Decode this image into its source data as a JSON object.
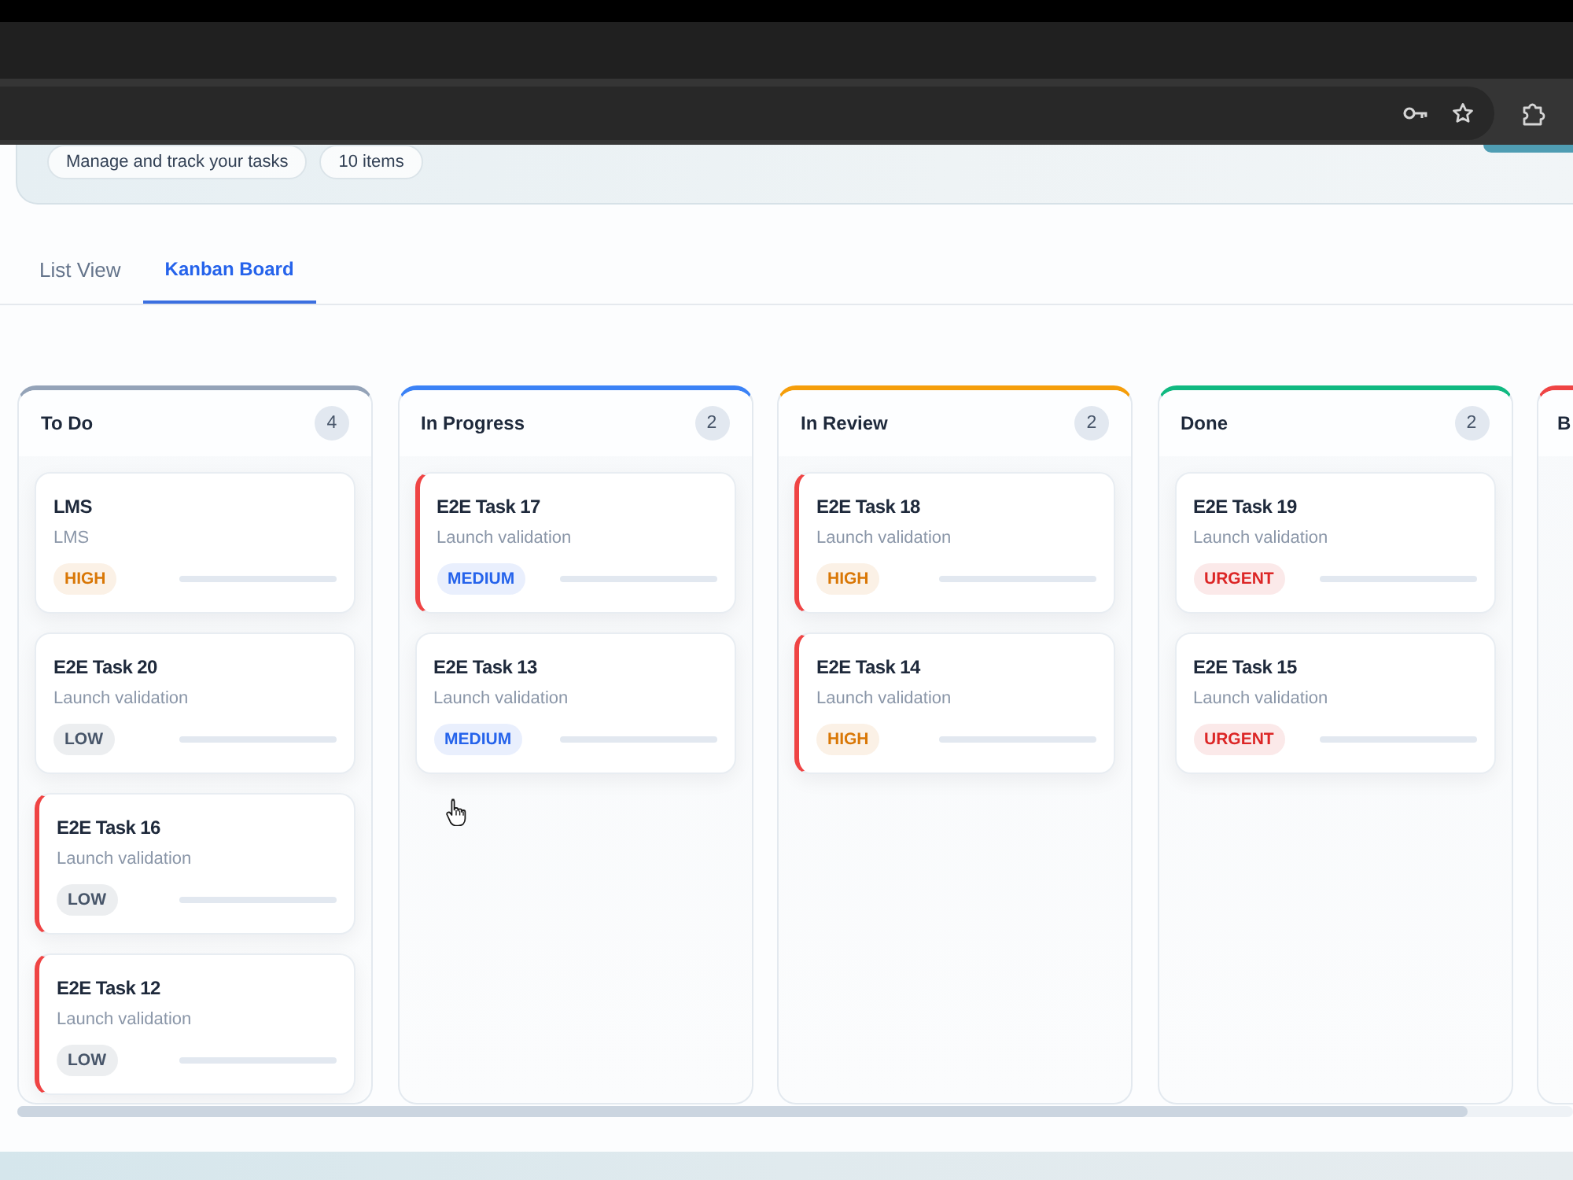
{
  "header": {
    "chips": [
      "Manage and track your tasks",
      "10 items"
    ]
  },
  "tabs": [
    {
      "label": "List View",
      "selected": false
    },
    {
      "label": "Kanban Board",
      "selected": true
    }
  ],
  "board": {
    "columns": [
      {
        "title": "To Do",
        "count": "4",
        "color": "#94a3b8",
        "cards": [
          {
            "title": "LMS",
            "description": "LMS",
            "priority": {
              "label": "HIGH",
              "color": "#d97706"
            },
            "level": 0,
            "flagged": false
          },
          {
            "title": "E2E Task 20",
            "description": "Launch validation",
            "priority": {
              "label": "LOW",
              "color": "#475569"
            },
            "level": 0,
            "flagged": false
          },
          {
            "title": "E2E Task 16",
            "description": "Launch validation",
            "priority": {
              "label": "LOW",
              "color": "#475569"
            },
            "level": 0,
            "flagged": true
          },
          {
            "title": "E2E Task 12",
            "description": "Launch validation",
            "priority": {
              "label": "LOW",
              "color": "#475569"
            },
            "level": 0,
            "flagged": true
          }
        ]
      },
      {
        "title": "In Progress",
        "count": "2",
        "color": "#3b82f6",
        "cards": [
          {
            "title": "E2E Task 17",
            "description": "Launch validation",
            "priority": {
              "label": "MEDIUM",
              "color": "#2563eb"
            },
            "level": 0,
            "flagged": true
          },
          {
            "title": "E2E Task 13",
            "description": "Launch validation",
            "priority": {
              "label": "MEDIUM",
              "color": "#2563eb"
            },
            "level": 0,
            "flagged": false
          }
        ]
      },
      {
        "title": "In Review",
        "count": "2",
        "color": "#f59e0b",
        "cards": [
          {
            "title": "E2E Task 18",
            "description": "Launch validation",
            "priority": {
              "label": "HIGH",
              "color": "#d97706"
            },
            "level": 0,
            "flagged": true
          },
          {
            "title": "E2E Task 14",
            "description": "Launch validation",
            "priority": {
              "label": "HIGH",
              "color": "#d97706"
            },
            "level": 0,
            "flagged": true
          }
        ]
      },
      {
        "title": "Done",
        "count": "2",
        "color": "#10b981",
        "cards": [
          {
            "title": "E2E Task 19",
            "description": "Launch validation",
            "priority": {
              "label": "URGENT",
              "color": "#dc2626"
            },
            "level": 0,
            "flagged": false
          },
          {
            "title": "E2E Task 15",
            "description": "Launch validation",
            "priority": {
              "label": "URGENT",
              "color": "#dc2626"
            },
            "level": 0,
            "flagged": false
          }
        ]
      },
      {
        "title": "B",
        "color": "#ef4444"
      }
    ]
  }
}
